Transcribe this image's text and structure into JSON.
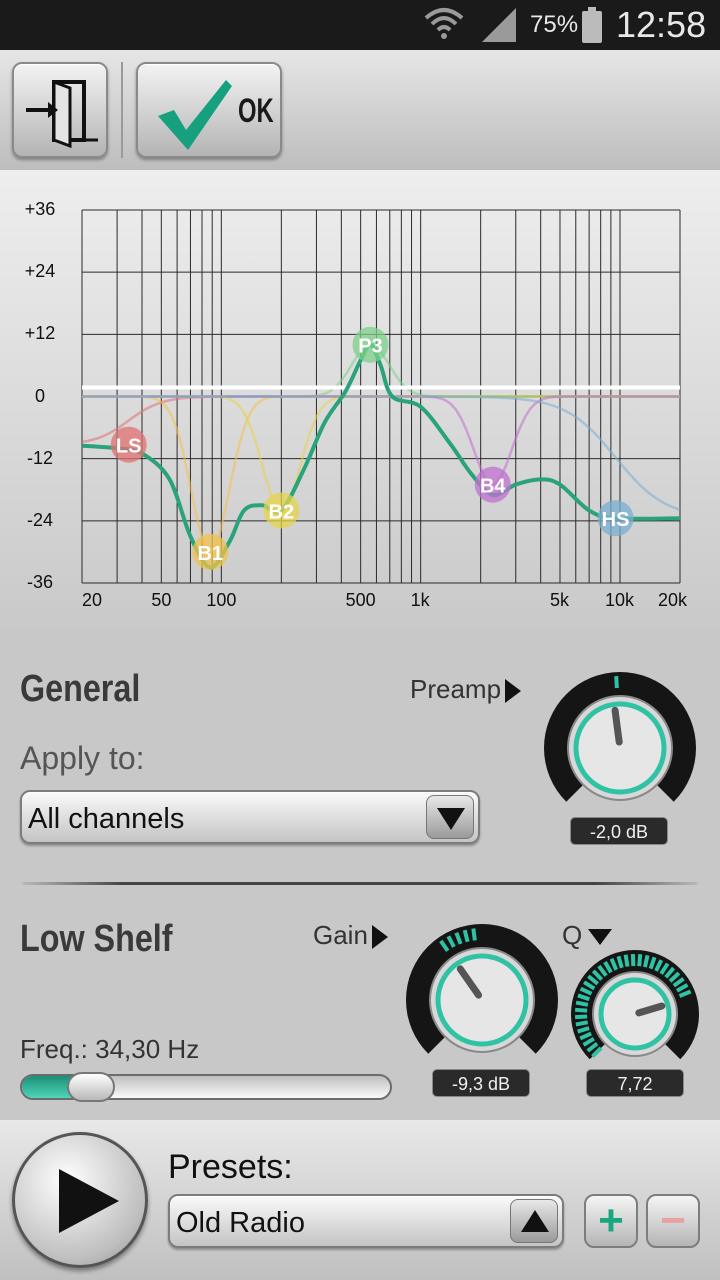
{
  "status_bar": {
    "battery": "75%",
    "time": "12:58"
  },
  "toolbar": {
    "ok_label": "OK"
  },
  "chart_data": {
    "type": "line",
    "xscale": "log",
    "xlim": [
      20,
      20000
    ],
    "ylim": [
      -36,
      36
    ],
    "x_ticks": [
      "20",
      "50",
      "100",
      "500",
      "1k",
      "5k",
      "10k",
      "20k"
    ],
    "y_ticks": [
      "+36",
      "+24",
      "+12",
      "0",
      "-12",
      "-24",
      "-36"
    ],
    "zero_line": 0,
    "bands": [
      {
        "label": "LS",
        "freq": 34.3,
        "gain": -9.3,
        "color": "#e07070"
      },
      {
        "label": "B1",
        "freq": 88,
        "gain": -30,
        "color": "#f2c14e"
      },
      {
        "label": "B2",
        "freq": 200,
        "gain": -22,
        "color": "#e6d44a"
      },
      {
        "label": "P3",
        "freq": 560,
        "gain": 10,
        "color": "#7cd08a"
      },
      {
        "label": "B4",
        "freq": 2300,
        "gain": -17,
        "color": "#c070d0"
      },
      {
        "label": "HS",
        "freq": 9500,
        "gain": -23.5,
        "color": "#7aaed0"
      }
    ],
    "total_response": [
      [
        20,
        -9.5
      ],
      [
        30,
        -10
      ],
      [
        40,
        -11
      ],
      [
        55,
        -16
      ],
      [
        70,
        -27
      ],
      [
        88,
        -33
      ],
      [
        110,
        -28
      ],
      [
        130,
        -22
      ],
      [
        160,
        -21
      ],
      [
        200,
        -22
      ],
      [
        260,
        -14
      ],
      [
        330,
        -5
      ],
      [
        420,
        1
      ],
      [
        500,
        7
      ],
      [
        560,
        10
      ],
      [
        630,
        6
      ],
      [
        720,
        0
      ],
      [
        1000,
        -2
      ],
      [
        1400,
        -9
      ],
      [
        1800,
        -15
      ],
      [
        2300,
        -19
      ],
      [
        3000,
        -17
      ],
      [
        4000,
        -16
      ],
      [
        5000,
        -17
      ],
      [
        7000,
        -22
      ],
      [
        9500,
        -23.5
      ],
      [
        20000,
        -23.5
      ]
    ]
  },
  "general": {
    "title": "General",
    "apply_label": "Apply to:",
    "apply_value": "All channels",
    "preamp_label": "Preamp",
    "preamp_value": "-2,0 dB",
    "preamp_db": -2.0
  },
  "band": {
    "title": "Low Shelf",
    "gain_label": "Gain",
    "q_label": "Q",
    "gain_value": "-9,3 dB",
    "gain_db": -9.3,
    "q_value": "7,72",
    "freq_text": "Freq.: 34,30 Hz",
    "freq_position": 0.14
  },
  "presets": {
    "label": "Presets:",
    "value": "Old Radio"
  },
  "colors": {
    "accent": "#2fc2a4",
    "curve": "#2aa37a"
  }
}
